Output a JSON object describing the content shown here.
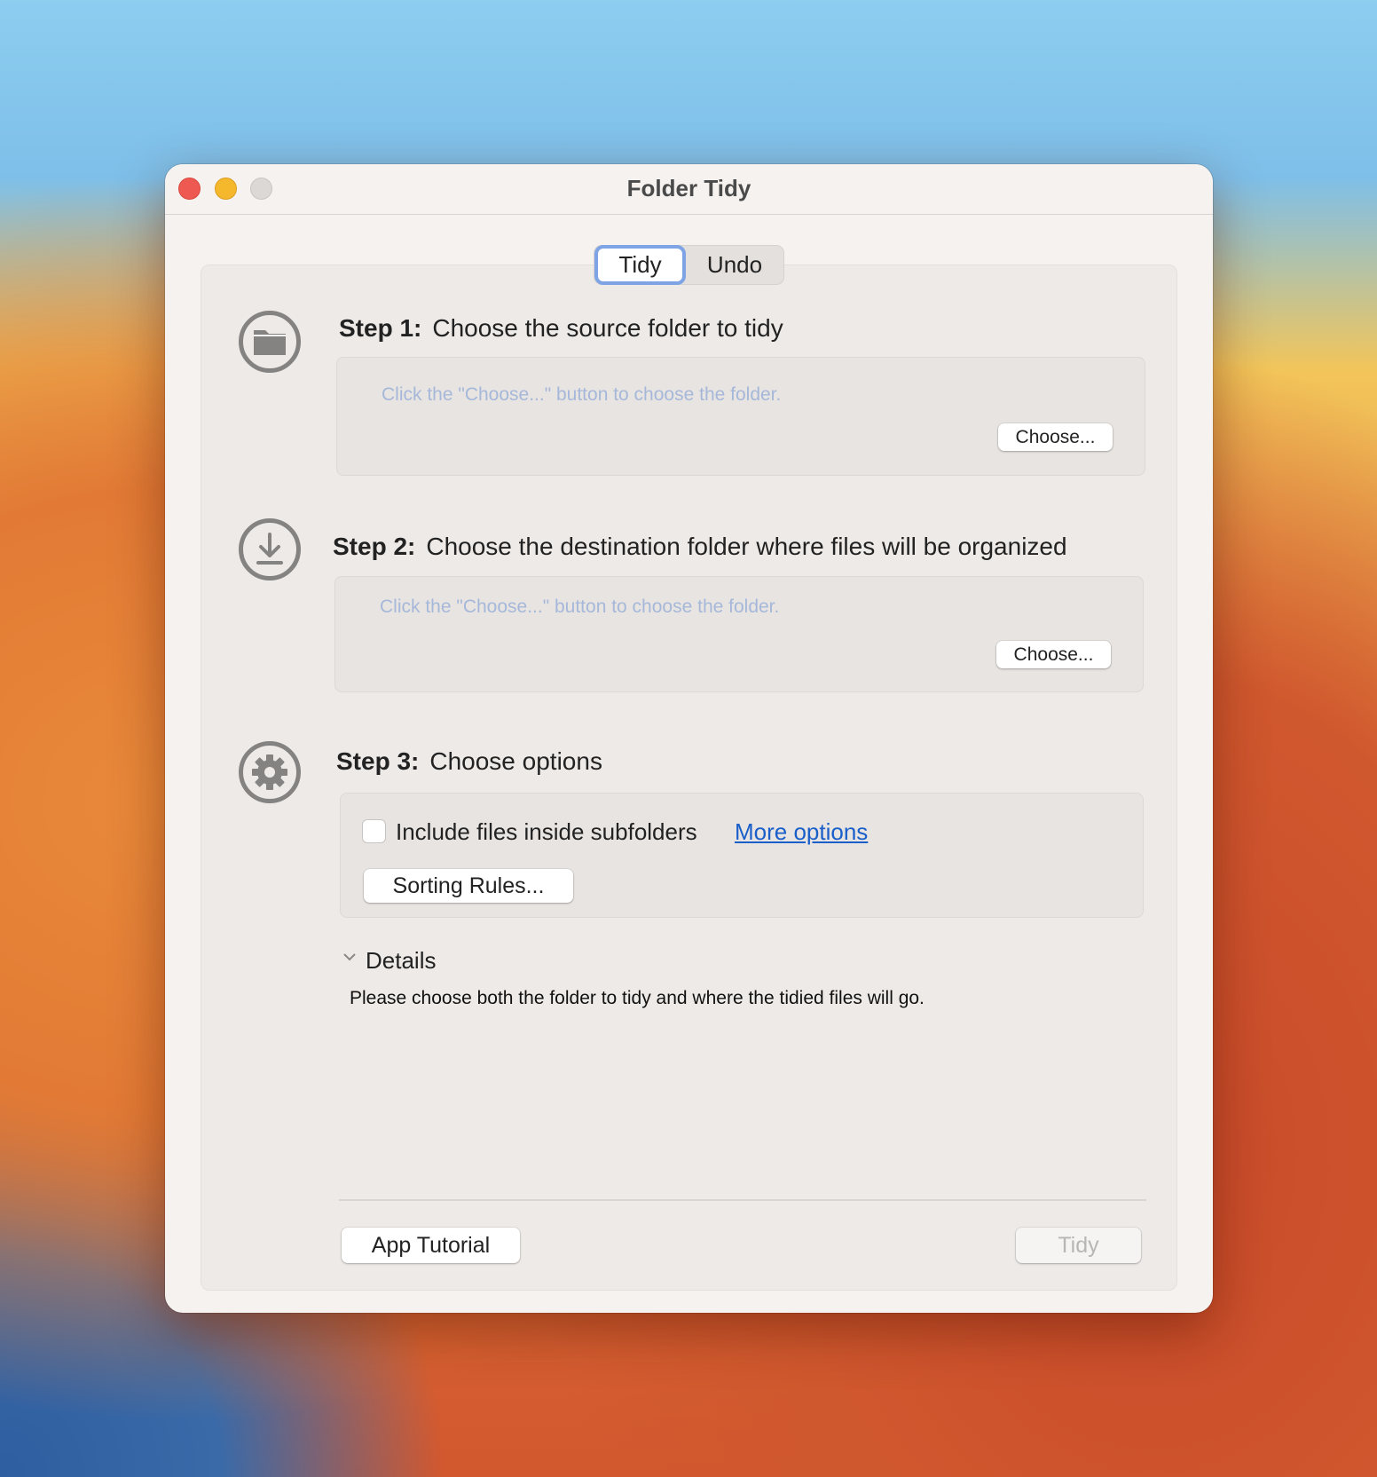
{
  "window": {
    "title": "Folder Tidy"
  },
  "segmented": {
    "tabs": [
      {
        "label": "Tidy",
        "selected": true
      },
      {
        "label": "Undo",
        "selected": false
      }
    ]
  },
  "steps": [
    {
      "label": "Step 1:",
      "title": "Choose the source folder to tidy",
      "placeholder": "Click the \"Choose...\" button to choose the folder.",
      "button": "Choose...",
      "icon": "folder-icon"
    },
    {
      "label": "Step 2:",
      "title": "Choose the destination folder where files will be organized",
      "placeholder": "Click the \"Choose...\" button to choose the folder.",
      "button": "Choose...",
      "icon": "download-icon"
    },
    {
      "label": "Step 3:",
      "title": "Choose options",
      "icon": "gear-icon"
    }
  ],
  "options": {
    "checkbox_label": "Include files inside subfolders",
    "checked": false,
    "more_options": "More options",
    "sorting_rules": "Sorting Rules..."
  },
  "details": {
    "label": "Details",
    "text": "Please choose both the folder to tidy and where the tidied files will go."
  },
  "footer": {
    "tutorial": "App Tutorial",
    "tidy": "Tidy"
  },
  "colors": {
    "link": "#1a5fc9",
    "focus": "#7fa4e6"
  }
}
